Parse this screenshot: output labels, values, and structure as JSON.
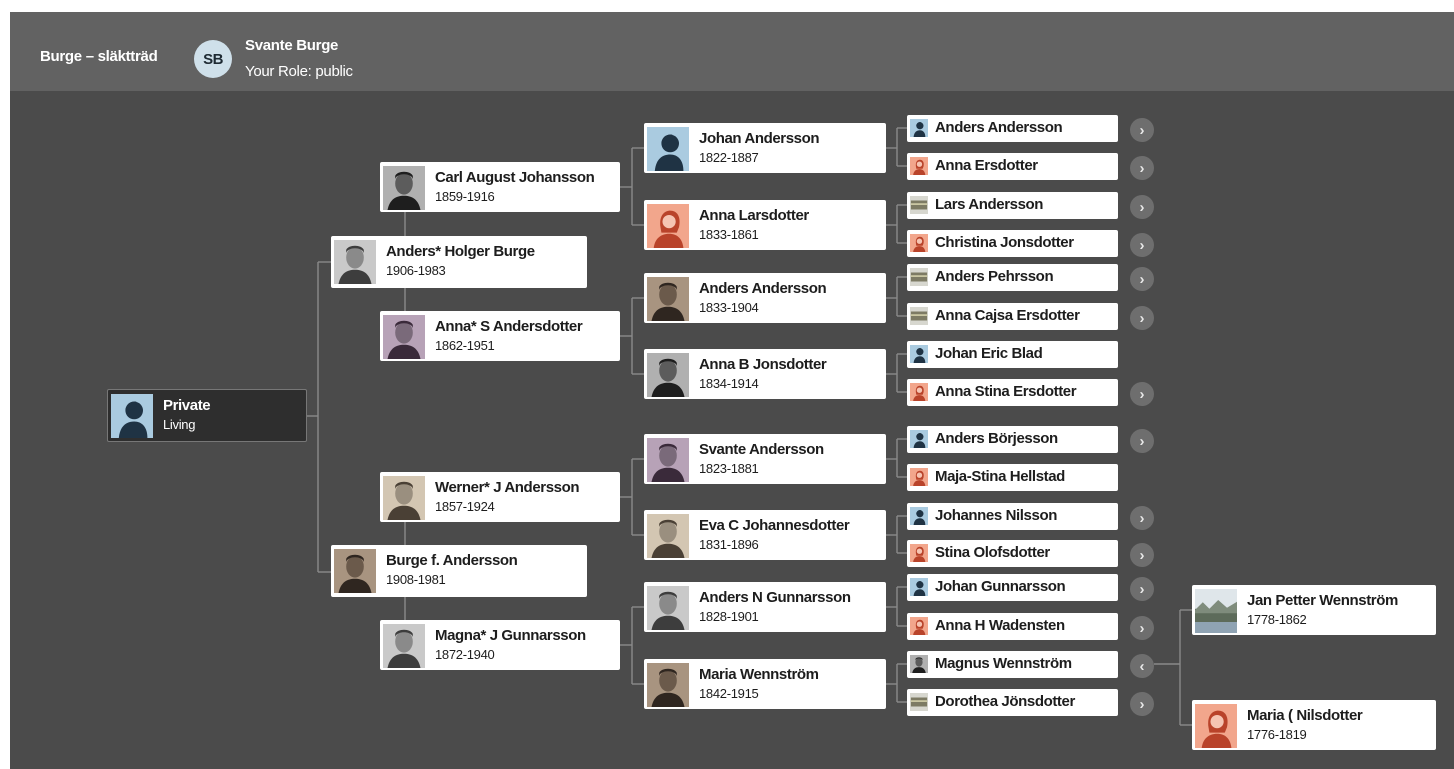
{
  "header": {
    "title": "Burge – släktträd",
    "user_initials": "SB",
    "user_name": "Svante Burge",
    "role_text": "Your Role: public"
  },
  "colors": {
    "app_background": "#4b4b4b",
    "header_background": "#626262",
    "connector_line": "#8a8a8a",
    "card_background": "#ffffff",
    "selected_card_background": "#2e2e2e",
    "male_silhouette_background": "#aacbe0",
    "female_silhouette_background": "#f2a68c"
  },
  "tree": {
    "root": {
      "name": "Private",
      "years": "Living",
      "photo": "male-silhouette-icon"
    },
    "parents": [
      {
        "name": "Anders* Holger Burge",
        "years": "1906-1983",
        "photo": "portrait-photo"
      },
      {
        "name": "Burge f. Andersson",
        "years": "1908-1981",
        "photo": "portrait-photo"
      }
    ],
    "grandparents": [
      {
        "name": "Carl August Johansson",
        "years": "1859-1916",
        "photo": "portrait-photo"
      },
      {
        "name": "Anna* S Andersdotter",
        "years": "1862-1951",
        "photo": "portrait-photo"
      },
      {
        "name": "Werner* J Andersson",
        "years": "1857-1924",
        "photo": "portrait-photo"
      },
      {
        "name": "Magna* J Gunnarsson",
        "years": "1872-1940",
        "photo": "portrait-photo"
      }
    ],
    "great_grandparents": [
      {
        "name": "Johan Andersson",
        "years": "1822-1887",
        "photo": "male-silhouette-icon"
      },
      {
        "name": "Anna Larsdotter",
        "years": "1833-1861",
        "photo": "female-silhouette-icon"
      },
      {
        "name": "Anders Andersson",
        "years": "1833-1904",
        "photo": "portrait-photo"
      },
      {
        "name": "Anna B Jonsdotter",
        "years": "1834-1914",
        "photo": "portrait-photo"
      },
      {
        "name": "Svante Andersson",
        "years": "1823-1881",
        "photo": "portrait-photo"
      },
      {
        "name": "Eva C Johannesdotter",
        "years": "1831-1896",
        "photo": "portrait-photo"
      },
      {
        "name": "Anders N Gunnarsson",
        "years": "1828-1901",
        "photo": "portrait-photo"
      },
      {
        "name": "Maria Wennström",
        "years": "1842-1915",
        "photo": "portrait-photo"
      }
    ],
    "gen4": [
      {
        "name": "Anders Andersson",
        "icon": "male-silhouette-icon",
        "has_more": true
      },
      {
        "name": "Anna Ersdotter",
        "icon": "female-silhouette-icon",
        "has_more": true
      },
      {
        "name": "Lars Andersson",
        "icon": "document-thumbnail-icon",
        "has_more": true
      },
      {
        "name": "Christina Jonsdotter",
        "icon": "female-silhouette-icon",
        "has_more": true
      },
      {
        "name": "Anders Pehrsson",
        "icon": "document-thumbnail-icon",
        "has_more": true
      },
      {
        "name": "Anna Cajsa Ersdotter",
        "icon": "document-thumbnail-icon",
        "has_more": true
      },
      {
        "name": "Johan Eric Blad",
        "icon": "male-silhouette-icon",
        "has_more": false
      },
      {
        "name": "Anna Stina Ersdotter",
        "icon": "female-silhouette-icon",
        "has_more": true
      },
      {
        "name": "Anders Börjesson",
        "icon": "male-silhouette-icon",
        "has_more": true
      },
      {
        "name": "Maja-Stina Hellstad",
        "icon": "female-silhouette-icon",
        "has_more": false
      },
      {
        "name": "Johannes Nilsson",
        "icon": "male-silhouette-icon",
        "has_more": true
      },
      {
        "name": "Stina Olofsdotter",
        "icon": "female-silhouette-icon",
        "has_more": true
      },
      {
        "name": "Johan Gunnarsson",
        "icon": "male-silhouette-icon",
        "has_more": true
      },
      {
        "name": "Anna H Wadensten",
        "icon": "female-silhouette-icon",
        "has_more": true
      },
      {
        "name": "Magnus Wennström",
        "icon": "portrait-photo",
        "has_more": "collapse"
      },
      {
        "name": "Dorothea Jönsdotter",
        "icon": "document-thumbnail-icon",
        "has_more": true
      }
    ],
    "gen5": [
      {
        "name": "Jan Petter Wennström",
        "years": "1778-1862",
        "photo": "landscape-photo"
      },
      {
        "name": "Maria ( Nilsdotter",
        "years": "1776-1819",
        "photo": "female-silhouette-icon"
      }
    ]
  }
}
